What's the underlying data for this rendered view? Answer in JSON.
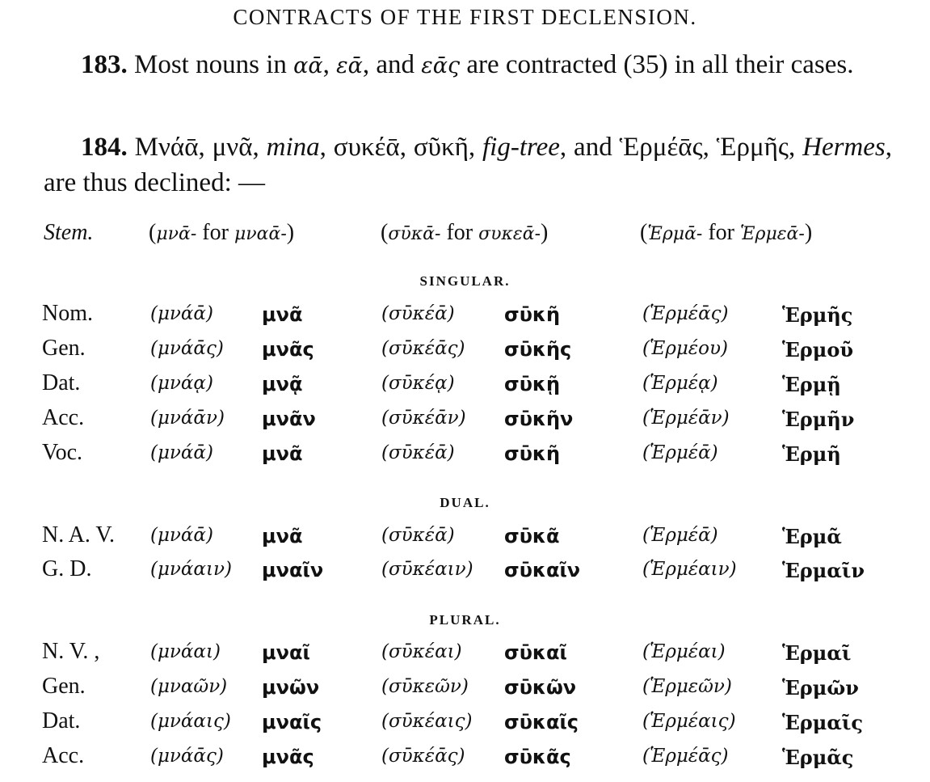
{
  "title": "CONTRACTS OF THE FIRST DECLENSION.",
  "para183": {
    "number": "183.",
    "text_a": " Most nouns in ",
    "gk1": "αᾱ",
    "sep1": ", ",
    "gk2": "εᾱ",
    "sep2": ", and ",
    "gk3": "εᾱς",
    "text_b": " are contracted (35) in all their cases."
  },
  "para184": {
    "number": "184.",
    "w1": " Μνάᾱ, μνᾶ, ",
    "gloss1": "mina",
    "w2": ", συκέᾱ, σῦκῆ, ",
    "gloss2": "fig-tree",
    "w3": ", and Ἑρμέᾱς, Ἑρμῆς, ",
    "gloss3": "Hermes",
    "text_end": ", are thus declined: —"
  },
  "stem": {
    "label": "Stem.",
    "col1": {
      "open": "(",
      "stem": "μνᾱ-",
      "for": " for ",
      "orig": "μναᾱ-",
      "close": ")"
    },
    "col2": {
      "open": "(",
      "stem": "σῡκᾱ-",
      "for": " for ",
      "orig": "συκεᾱ-",
      "close": ")"
    },
    "col3": {
      "open": "(",
      "stem": "Ἑρμᾱ-",
      "for": " for ",
      "orig": "Ἑρμεᾱ-",
      "close": ")"
    }
  },
  "sections": {
    "singular": "SINGULAR.",
    "dual": "DUAL.",
    "plural": "PLURAL."
  },
  "singular": [
    {
      "case": "Nom.",
      "f": [
        "(μνάᾱ)",
        "μνᾶ",
        "(σῡκέᾱ)",
        "σῡκῆ",
        "(Ἑρμέᾱς)",
        "Ἑρμῆς"
      ]
    },
    {
      "case": "Gen.",
      "f": [
        "(μνάᾱς)",
        "μνᾶς",
        "(σῡκέᾱς)",
        "σῡκῆς",
        "(Ἑρμέου)",
        "Ἑρμοῦ"
      ]
    },
    {
      "case": "Dat.",
      "f": [
        "(μνάᾳ)",
        "μνᾷ",
        "(σῡκέᾳ)",
        "σῡκῇ",
        "(Ἑρμέᾳ)",
        "Ἑρμῇ"
      ]
    },
    {
      "case": "Acc.",
      "f": [
        "(μνάᾱν)",
        "μνᾶν",
        "(σῡκέᾱν)",
        "σῡκῆν",
        "(Ἑρμέᾱν)",
        "Ἑρμῆν"
      ]
    },
    {
      "case": "Voc.",
      "f": [
        "(μνάᾱ)",
        "μνᾶ",
        "(σῡκέᾱ)",
        "σῡκῆ",
        "(Ἑρμέᾱ)",
        "Ἑρμῆ"
      ]
    }
  ],
  "dual": [
    {
      "case": "N. A. V.",
      "f": [
        "(μνάᾱ)",
        "μνᾶ",
        "(σῡκέᾱ)",
        "σῡκᾶ",
        "(Ἑρμέᾱ)",
        "Ἑρμᾶ"
      ]
    },
    {
      "case": "G. D.",
      "f": [
        "(μνάαιν)",
        "μναῖν",
        "(σῡκέαιν)",
        "σῡκαῖν",
        "(Ἑρμέαιν)",
        "Ἑρμαῖν"
      ]
    }
  ],
  "plural": [
    {
      "case": "N. V. ,",
      "f": [
        "(μνάαι)",
        "μναῖ",
        "(σῡκέαι)",
        "σῡκαῖ",
        "(Ἑρμέαι)",
        "Ἑρμαῖ"
      ]
    },
    {
      "case": "Gen.",
      "f": [
        "(μναῶν)",
        "μνῶν",
        "(σῡκεῶν)",
        "σῡκῶν",
        "(Ἑρμεῶν)",
        "Ἑρμῶν"
      ]
    },
    {
      "case": "Dat.",
      "f": [
        "(μνάαις)",
        "μναῖς",
        "(σῡκέαις)",
        "σῡκαῖς",
        "(Ἑρμέαις)",
        "Ἑρμαῖς"
      ]
    },
    {
      "case": "Acc.",
      "f": [
        "(μνάᾱς)",
        "μνᾶς",
        "(σῡκέᾱς)",
        "σῡκᾶς",
        "(Ἑρμέᾱς)",
        "Ἑρμᾶς"
      ]
    }
  ]
}
